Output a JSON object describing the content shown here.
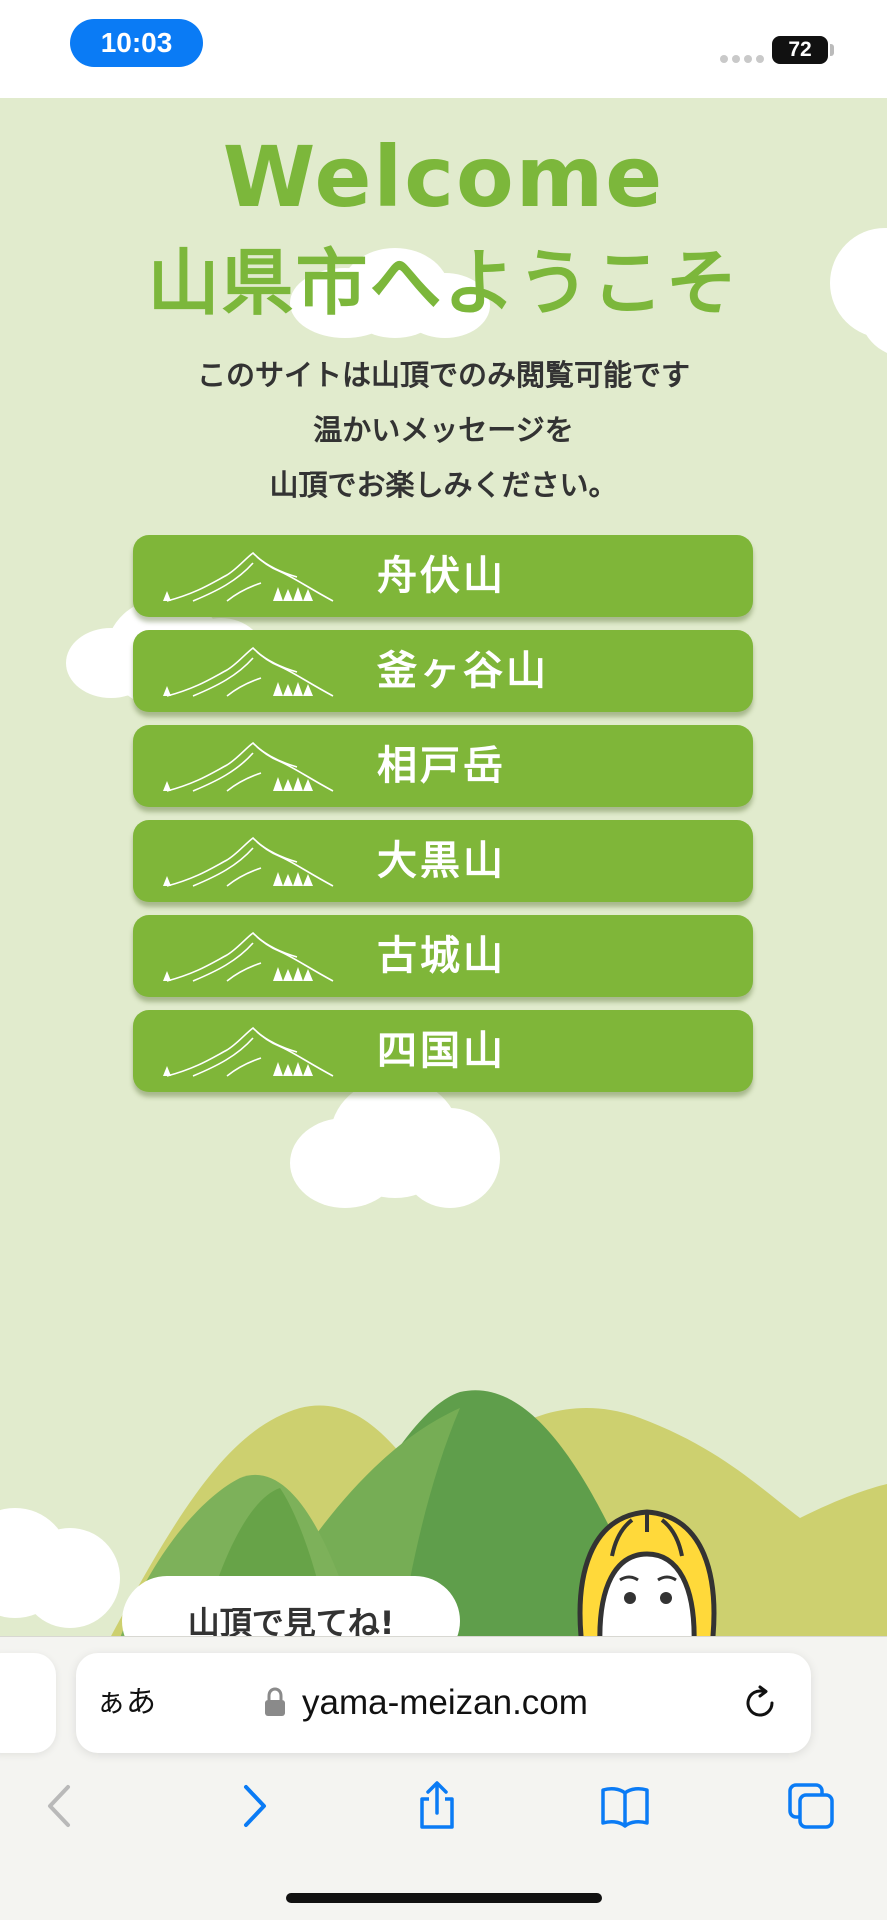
{
  "status_bar": {
    "time": "10:03",
    "battery": "72"
  },
  "page": {
    "welcome_en": "Welcome",
    "welcome_ja": "山県市へようこそ",
    "intro_lines": [
      "このサイトは山頂でのみ閲覧可能です",
      "温かいメッセージを",
      "山頂でお楽しみください。"
    ],
    "mountains": [
      "舟伏山",
      "釜ヶ谷山",
      "相戸岳",
      "大黒山",
      "古城山",
      "四国山"
    ],
    "bubble_text": "山頂で見てね!"
  },
  "safari": {
    "aa_label": "ぁあ",
    "url": "yama-meizan.com"
  },
  "colors": {
    "accent_green": "#7fb639",
    "title_green": "#7cb73b",
    "page_background": "#e1ebcd",
    "time_pill_blue": "#0a7bf5",
    "ios_tint": "#0a7bf5"
  },
  "icons": {
    "back": "chevron-left-icon",
    "forward": "chevron-right-icon",
    "share": "share-icon",
    "bookmarks": "book-icon",
    "tabs": "tabs-icon",
    "lock": "lock-icon",
    "reload": "reload-icon"
  }
}
